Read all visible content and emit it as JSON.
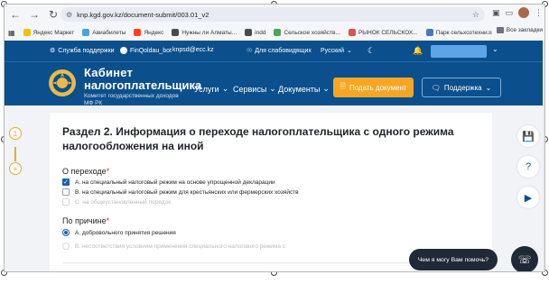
{
  "browser": {
    "url": "knp.kgd.gov.kz/document-submit/003.01_v2",
    "bookmarks": [
      {
        "label": "Яндекс Маркет",
        "color": "#f2c200"
      },
      {
        "label": "Авиабилеты",
        "color": "#4aa3df"
      },
      {
        "label": "Яндекс",
        "color": "#fc3f1d"
      },
      {
        "label": "Нужны ли Алматы...",
        "color": "#4a4a4a"
      },
      {
        "label": "indd",
        "color": "#4a4a4a"
      },
      {
        "label": "Сельское хозяйств...",
        "color": "#55a05a"
      },
      {
        "label": "РЫНОК СЕЛЬСКОХ...",
        "color": "#d9534f"
      },
      {
        "label": "Парк сельхозтехни...",
        "color": "#4a76b8"
      }
    ],
    "bookmarks_all": "Все закладки"
  },
  "header": {
    "support_service": "Служба поддержки",
    "telegram_bot": "FinQoldau_bot",
    "email": "knpsd@ecc.kz",
    "accessibility": "Для слабовидящих",
    "language": "Русский",
    "brand_line1": "Кабинет",
    "brand_line2": "налогоплательщика",
    "brand_line3": "Комитет государственных доходов",
    "brand_line4": "МФ РК",
    "menu": [
      "Услуги",
      "Сервисы",
      "Документы"
    ],
    "submit_button": "Подать документ",
    "support_button": "Поддержка"
  },
  "steps": [
    "1",
    "+"
  ],
  "form": {
    "title": "Раздел 2. Информация о переходе налогоплательщика с одного режима налогообложения на иной",
    "transition_label": "О переходе",
    "transition_options": [
      {
        "label": "А. на специальный налоговый режим на основе упрощенной декларации",
        "checked": true,
        "disabled": false
      },
      {
        "label": "В. на специальный налоговый режим для крестьянских или фермерских хозяйств",
        "checked": false,
        "disabled": false
      },
      {
        "label": "С. на общеустановленный порядок",
        "checked": false,
        "disabled": true
      }
    ],
    "reason_label": "По причине",
    "reason_options": [
      {
        "label": "А. добровольного принятия решения",
        "checked": true,
        "disabled": false
      },
      {
        "label": "В. несоответствия условиям применения специального налогового режима с",
        "checked": false,
        "disabled": true
      }
    ]
  },
  "chat": {
    "prompt": "Чем я могу Вам помочь?"
  },
  "colors": {
    "header_blue": "#0b4f8c",
    "accent_orange": "#f6a623",
    "checkbox_blue": "#1a5fb4"
  }
}
